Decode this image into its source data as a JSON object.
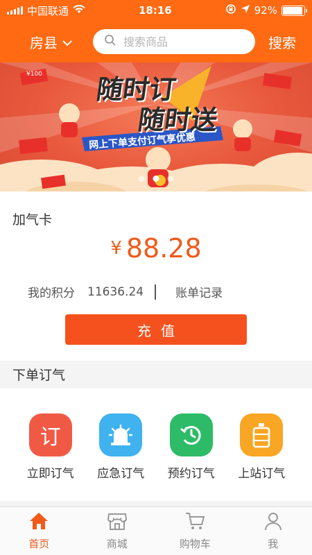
{
  "status_bar": {
    "carrier": "中国联通",
    "time": "18:16",
    "battery": "92%",
    "battery_level": 0.92
  },
  "header": {
    "city": "房县",
    "search_placeholder": "搜索商品",
    "search_button": "搜索"
  },
  "banner": {
    "headline_1": "随时订",
    "headline_2": "随时送",
    "tagline": "网上下单支付订气享优惠",
    "coupon_label": "¥100",
    "slide_count": 3,
    "active_slide": 1
  },
  "card": {
    "title": "加气卡",
    "currency": "¥",
    "balance": "88.28",
    "points_label": "我的积分",
    "points_value": "11636.24",
    "bill_link": "账单记录",
    "recharge_button": "充值"
  },
  "order_section": {
    "title": "下单订气",
    "items": [
      {
        "label": "立即订气",
        "icon": "order-icon",
        "glyph": "订",
        "color": "#f05a45"
      },
      {
        "label": "应急订气",
        "icon": "alarm-icon",
        "glyph": "",
        "color": "#3fb2ef"
      },
      {
        "label": "预约订气",
        "icon": "clock-icon",
        "glyph": "",
        "color": "#2dbb67"
      },
      {
        "label": "上站订气",
        "icon": "gas-cylinder-icon",
        "glyph": "",
        "color": "#f8a623"
      }
    ]
  },
  "tabbar": {
    "tabs": [
      {
        "label": "首页",
        "icon": "home-icon",
        "active": true
      },
      {
        "label": "商城",
        "icon": "store-icon",
        "active": false
      },
      {
        "label": "购物车",
        "icon": "cart-icon",
        "active": false
      },
      {
        "label": "我",
        "icon": "user-icon",
        "active": false
      }
    ]
  },
  "colors": {
    "brand": "#ff6a13",
    "accent": "#f05a1a",
    "button": "#f5511e"
  }
}
